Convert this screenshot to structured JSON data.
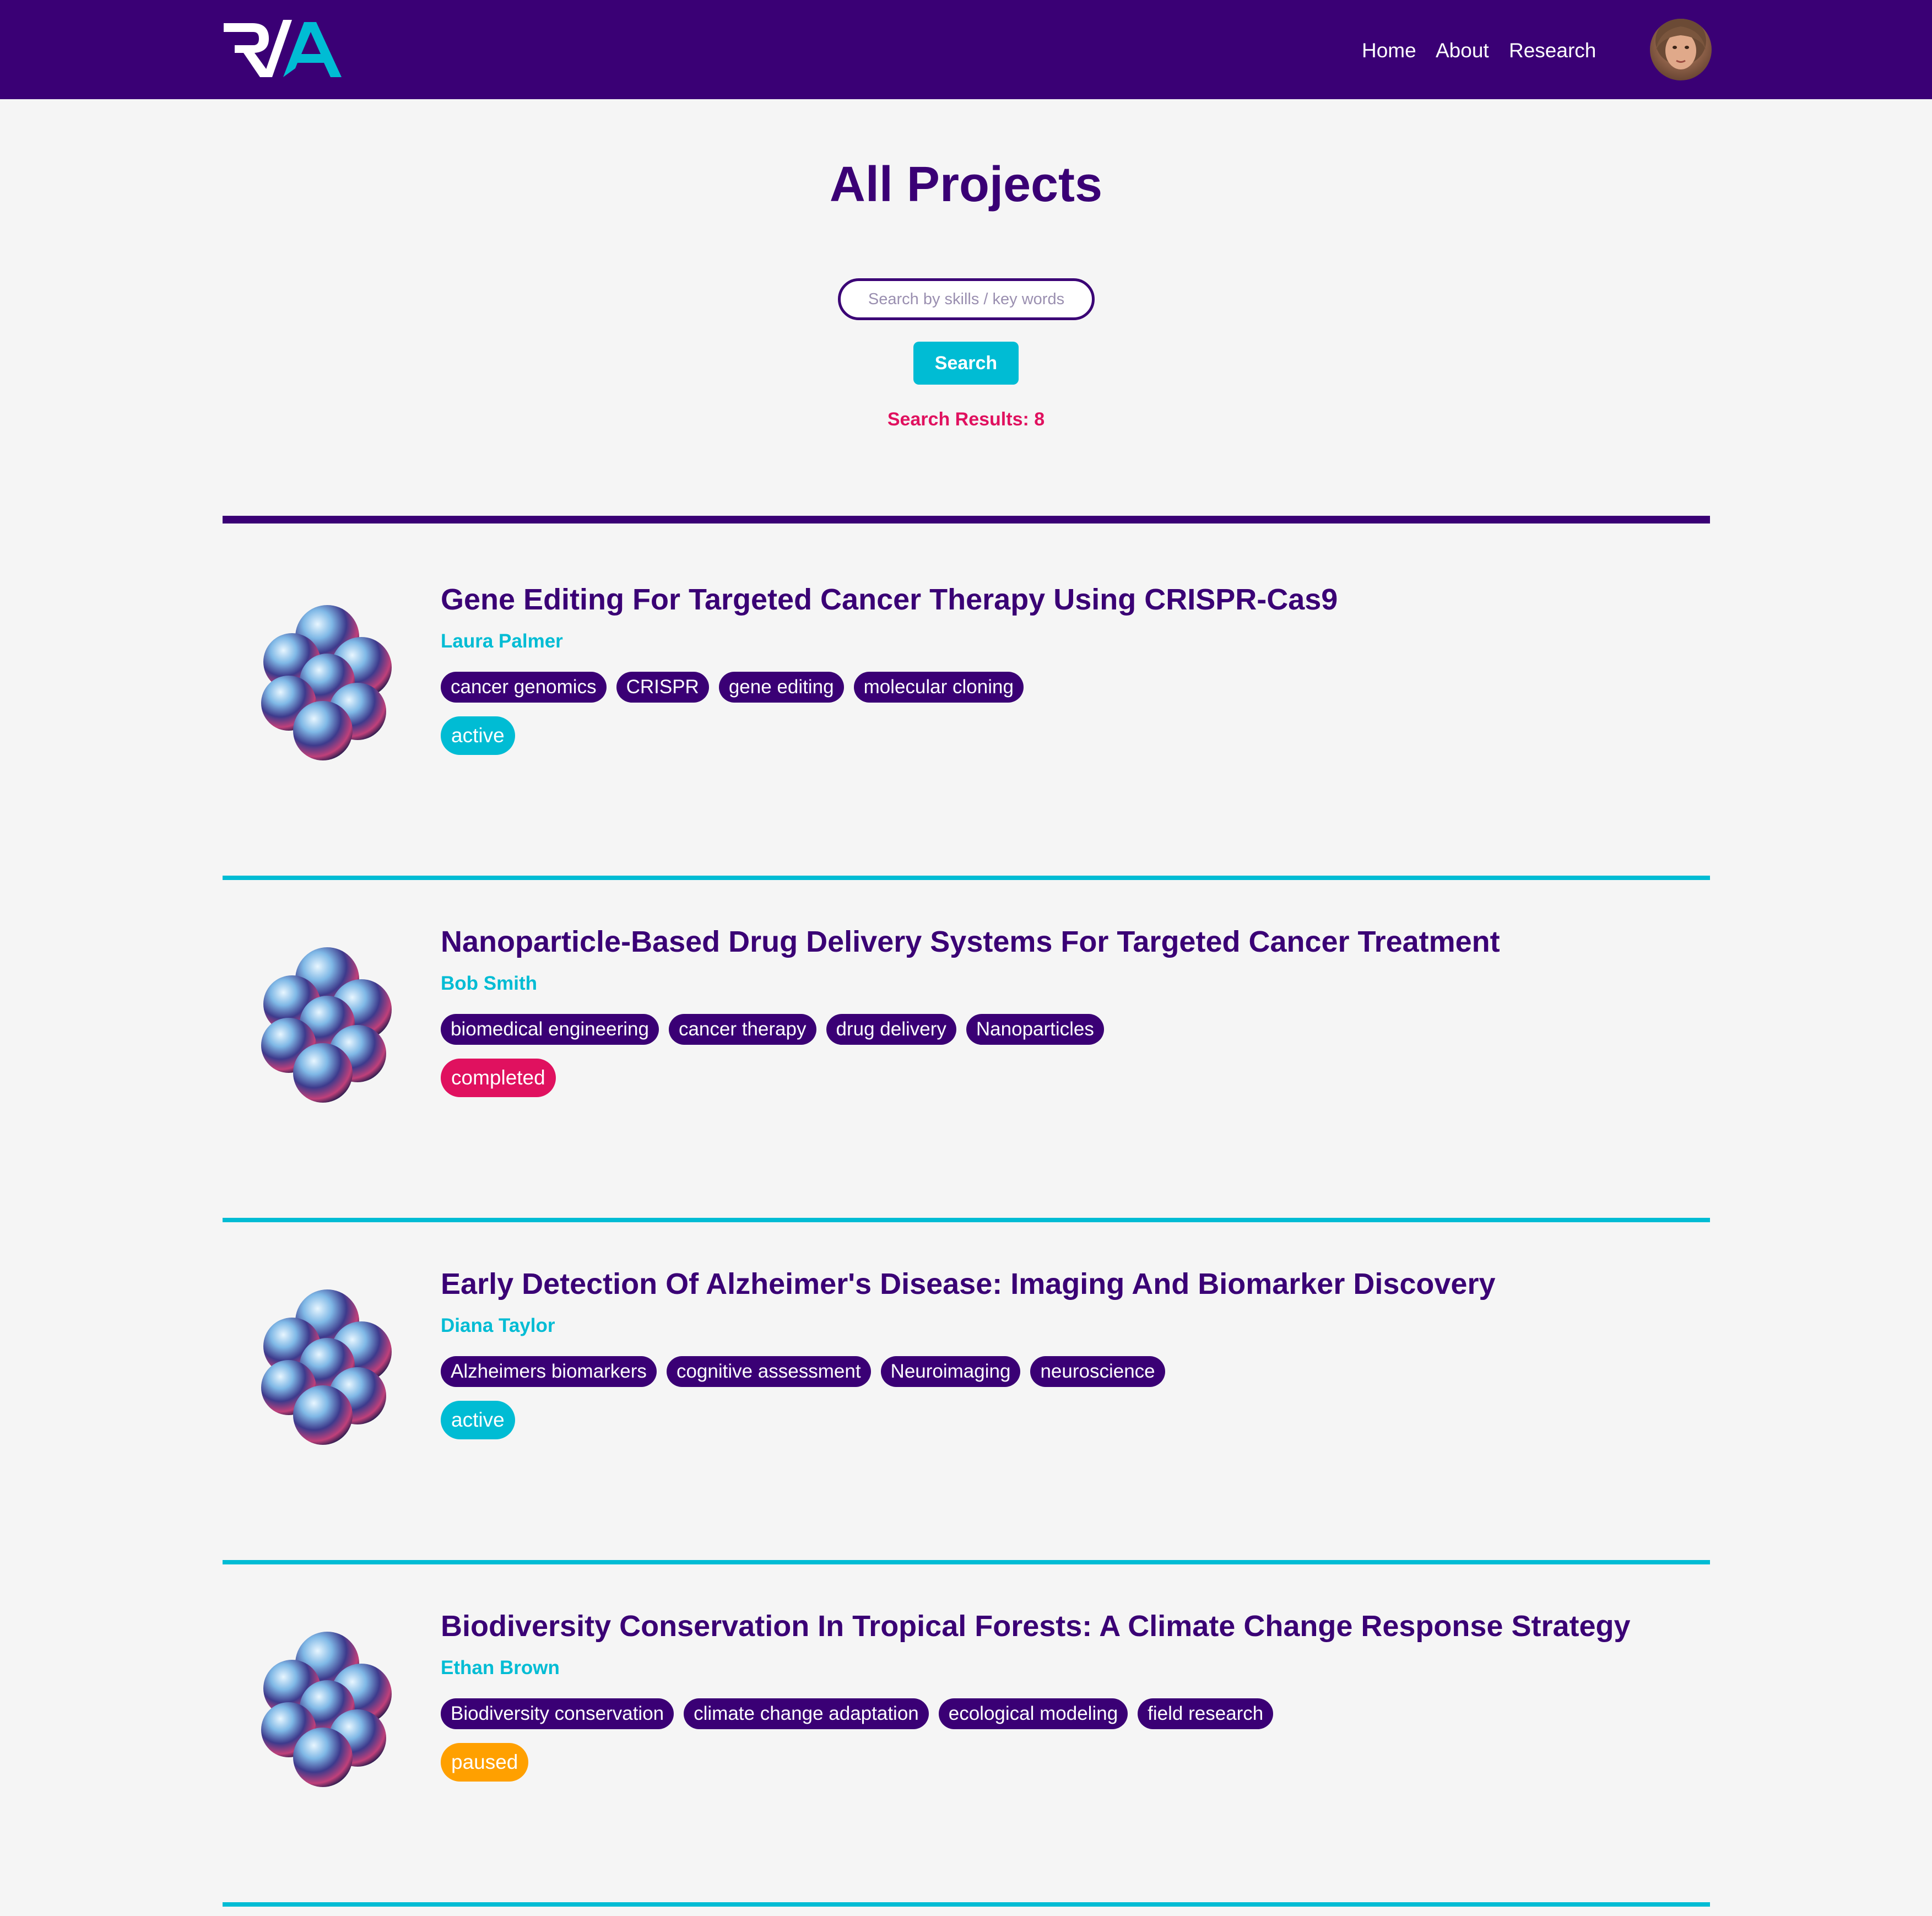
{
  "brand": {
    "logo_left": "R/",
    "logo_right": "A",
    "colors": {
      "primary": "#3a0075",
      "accent": "#00bcd4",
      "alert": "#e0115f",
      "paused": "#ffa000",
      "background": "#f5f5f5"
    }
  },
  "nav": {
    "home": "Home",
    "about": "About",
    "research": "Research"
  },
  "page": {
    "title": "All Projects"
  },
  "search": {
    "placeholder": "Search by skills / key words",
    "value": "",
    "button_label": "Search",
    "results_label": "Search Results:",
    "results_count": "8"
  },
  "status_colors": {
    "active": "#00bcd4",
    "completed": "#e0115f",
    "paused": "#ffa000"
  },
  "projects": [
    {
      "title": "Gene Editing For Targeted Cancer Therapy Using CRISPR-Cas9",
      "author": "Laura Palmer",
      "tags": [
        "cancer genomics",
        "CRISPR",
        "gene editing",
        "molecular cloning"
      ],
      "status": "active"
    },
    {
      "title": "Nanoparticle-Based Drug Delivery Systems For Targeted Cancer Treatment",
      "author": "Bob Smith",
      "tags": [
        "biomedical engineering",
        "cancer therapy",
        "drug delivery",
        "Nanoparticles"
      ],
      "status": "completed"
    },
    {
      "title": "Early Detection Of Alzheimer's Disease: Imaging And Biomarker Discovery",
      "author": "Diana Taylor",
      "tags": [
        "Alzheimers biomarkers",
        "cognitive assessment",
        "Neuroimaging",
        "neuroscience"
      ],
      "status": "active"
    },
    {
      "title": "Biodiversity Conservation In Tropical Forests: A Climate Change Response Strategy",
      "author": "Ethan Brown",
      "tags": [
        "Biodiversity conservation",
        "climate change adaptation",
        "ecological modeling",
        "field research"
      ],
      "status": "paused"
    }
  ]
}
